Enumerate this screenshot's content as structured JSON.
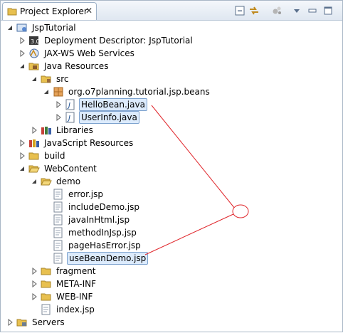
{
  "tab": {
    "label": "Project Explorer",
    "close": "✕"
  },
  "tree": [
    {
      "label": "JspTutorial",
      "expanded": true,
      "icon": "web-project-icon"
    },
    {
      "label": "Deployment Descriptor: JspTutorial",
      "expanded": false,
      "icon": "deployment-descriptor-icon"
    },
    {
      "label": "JAX-WS Web Services",
      "expanded": false,
      "icon": "web-services-icon"
    },
    {
      "label": "Java Resources",
      "expanded": true,
      "icon": "java-resources-icon"
    },
    {
      "label": "src",
      "expanded": true,
      "icon": "source-folder-icon"
    },
    {
      "label": "org.o7planning.tutorial.jsp.beans",
      "expanded": true,
      "icon": "package-icon"
    },
    {
      "label": "HelloBean.java",
      "expanded": false,
      "icon": "java-file-icon",
      "selected": true
    },
    {
      "label": "UserInfo.java",
      "expanded": false,
      "icon": "java-file-icon",
      "selected": true
    },
    {
      "label": "Libraries",
      "expanded": false,
      "icon": "libraries-icon"
    },
    {
      "label": "JavaScript Resources",
      "expanded": false,
      "icon": "javascript-resources-icon"
    },
    {
      "label": "build",
      "expanded": false,
      "icon": "folder-icon"
    },
    {
      "label": "WebContent",
      "expanded": true,
      "icon": "folder-open-icon"
    },
    {
      "label": "demo",
      "expanded": true,
      "icon": "folder-open-icon"
    },
    {
      "label": "error.jsp",
      "icon": "jsp-file-icon"
    },
    {
      "label": "includeDemo.jsp",
      "icon": "jsp-file-icon"
    },
    {
      "label": "javaInHtml.jsp",
      "icon": "jsp-file-icon"
    },
    {
      "label": "methodInJsp.jsp",
      "icon": "jsp-file-icon"
    },
    {
      "label": "pageHasError.jsp",
      "icon": "jsp-file-icon"
    },
    {
      "label": "useBeanDemo.jsp",
      "icon": "jsp-file-icon",
      "selected": true
    },
    {
      "label": "fragment",
      "expanded": false,
      "icon": "folder-icon"
    },
    {
      "label": "META-INF",
      "expanded": false,
      "icon": "folder-icon"
    },
    {
      "label": "WEB-INF",
      "expanded": false,
      "icon": "folder-icon"
    },
    {
      "label": "index.jsp",
      "icon": "jsp-file-icon"
    },
    {
      "label": "Servers",
      "expanded": false,
      "icon": "servers-folder-icon"
    }
  ],
  "colors": {
    "selection_border": "#7da2ce",
    "selection_fill": "#dcebfc",
    "annotation_red": "#e0262b"
  }
}
